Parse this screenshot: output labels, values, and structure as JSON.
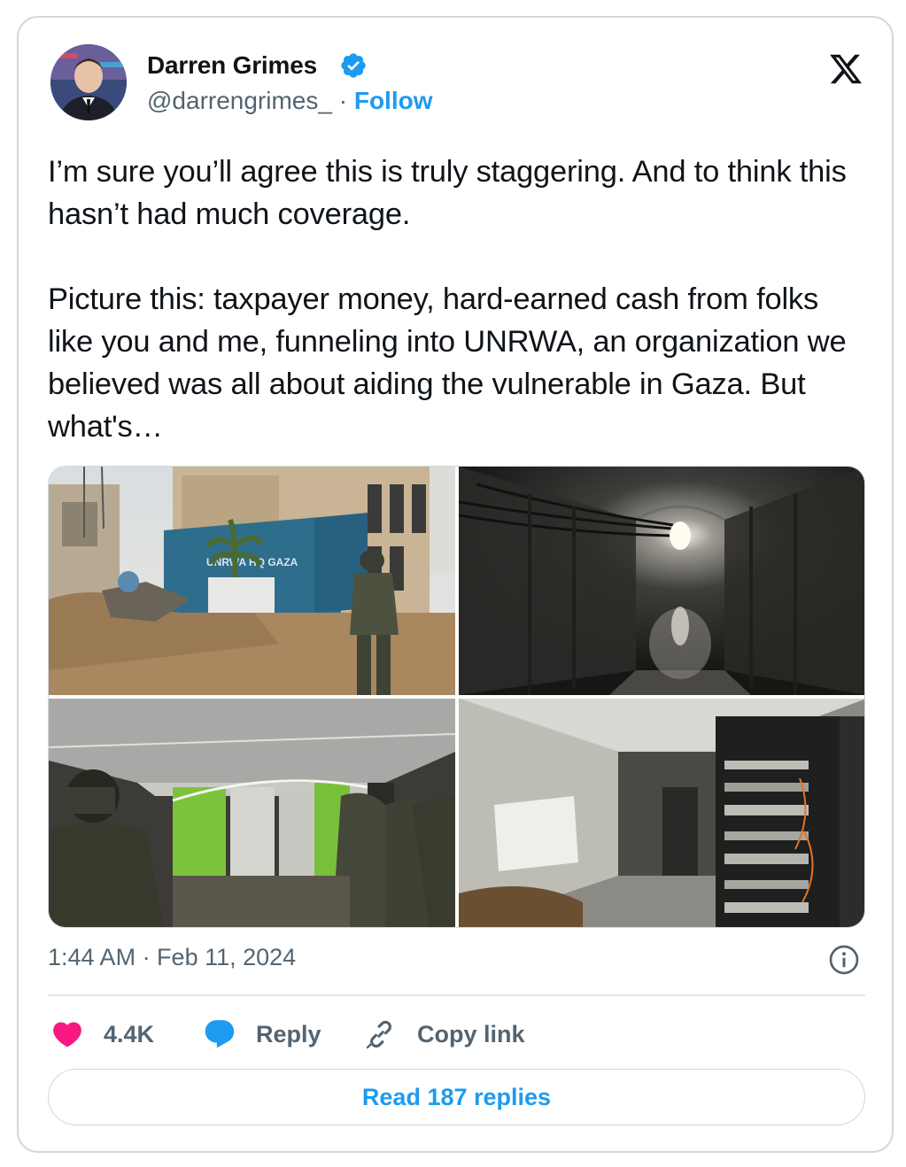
{
  "author": {
    "name": "Darren Grimes",
    "handle": "@darrengrimes_",
    "separator": " · ",
    "follow_label": "Follow",
    "verified": true
  },
  "icons": {
    "verified": "verified-badge-icon",
    "brand": "x-logo-icon",
    "info": "info-icon",
    "like": "heart-icon",
    "reply": "speech-bubble-icon",
    "copy": "link-icon"
  },
  "colors": {
    "accent": "#1d9bf0",
    "like": "#f91880",
    "muted": "#536471",
    "border": "#cfd9de"
  },
  "tweet": {
    "text": "I’m sure you’ll agree this is truly staggering. And to think this hasn’t had much coverage.\n\nPicture this: taxpayer money, hard-earned cash from folks like you and me, funneling into UNRWA, an organization we believed was all about aiding the vulnerable in Gaza. But what's…",
    "timestamp": "1:44 AM · Feb 11, 2024"
  },
  "media": {
    "image1_sign": "UNRWA HQ GAZA"
  },
  "actions": {
    "likes": "4.4K",
    "reply_label": "Reply",
    "copy_label": "Copy link",
    "read_replies_label": "Read 187 replies"
  }
}
